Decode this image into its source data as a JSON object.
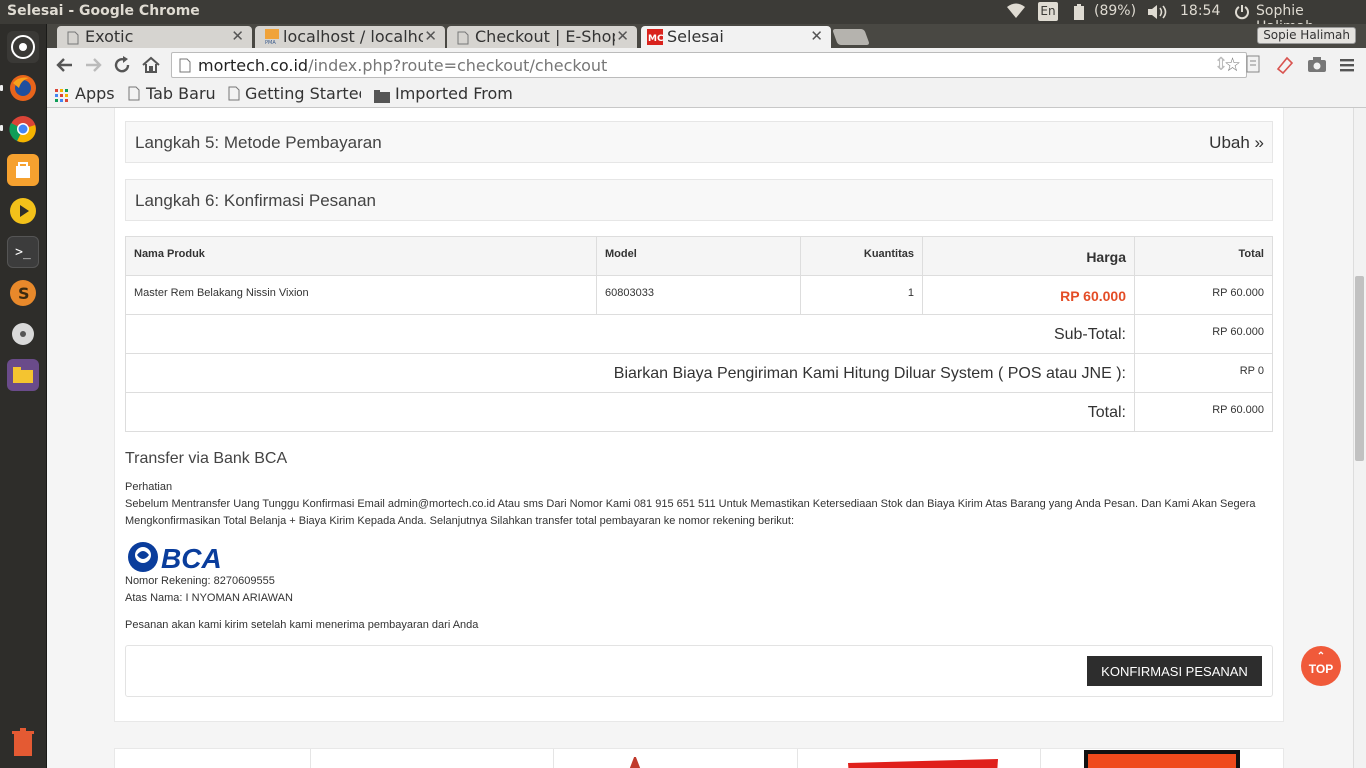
{
  "os": {
    "window_title": "Selesai - Google Chrome",
    "keyboard": "En",
    "battery": "(89%)",
    "time": "18:54",
    "user": "Sophie Halimah"
  },
  "browser": {
    "tabs": [
      {
        "title": "Exotic",
        "favicon": "page-icon"
      },
      {
        "title": "localhost / localho",
        "favicon": "phpmyadmin-icon"
      },
      {
        "title": "Checkout | E-Shop",
        "favicon": "page-icon"
      },
      {
        "title": "Selesai",
        "favicon": "site-logo-icon",
        "active": true
      }
    ],
    "profile": "Sopie Halimah",
    "url_domain": "mortech.co.id",
    "url_path": "/index.php?route=checkout/checkout",
    "bookmarks": [
      "Apps",
      "Tab Baru",
      "Getting Started",
      "Imported From"
    ]
  },
  "checkout": {
    "step5": {
      "title": "Langkah 5: Metode Pembayaran",
      "edit": "Ubah »"
    },
    "step6": {
      "title": "Langkah 6: Konfirmasi Pesanan"
    },
    "table": {
      "headers": [
        "Nama Produk",
        "Model",
        "Kuantitas",
        "Harga",
        "Total"
      ],
      "rows": [
        {
          "name": "Master Rem Belakang Nissin Vixion",
          "model": "60803033",
          "qty": "1",
          "price": "RP 60.000",
          "total": "RP 60.000"
        }
      ],
      "totals": [
        {
          "label": "Sub-Total:",
          "value": "RP 60.000"
        },
        {
          "label": "Biarkan Biaya Pengiriman Kami Hitung Diluar System ( POS atau JNE ):",
          "value": "RP 0"
        },
        {
          "label": "Total:",
          "value": "RP 60.000"
        }
      ]
    },
    "payment": {
      "title": "Transfer via Bank BCA",
      "attention": "Perhatian",
      "instructions": "Sebelum Mentransfer Uang Tunggu Konfirmasi Email admin@mortech.co.id Atau sms Dari Nomor Kami 081 915 651 511 Untuk Memastikan Ketersediaan Stok dan Biaya Kirim Atas Barang yang Anda Pesan. Dan Kami Akan Segera Mengkonfirmasikan Total Belanja + Biaya Kirim Kepada Anda. Selanjutnya Silahkan transfer total pembayaran ke nomor rekening berikut:",
      "bank_logo_text": "BCA",
      "account_number": "Nomor Rekening: 8270609555",
      "account_name": "Atas Nama: I NYOMAN ARIAWAN",
      "shipping_note": "Pesanan akan kami kirim setelah kami menerima pembayaran dari Anda"
    },
    "confirm_button": "KONFIRMASI PESANAN"
  },
  "top_button": "TOP",
  "colors": {
    "accent": "#e44d26",
    "top_button": "#f05a3a",
    "confirm_button": "#2d2d2d",
    "bca_blue": "#0a3d9c"
  }
}
